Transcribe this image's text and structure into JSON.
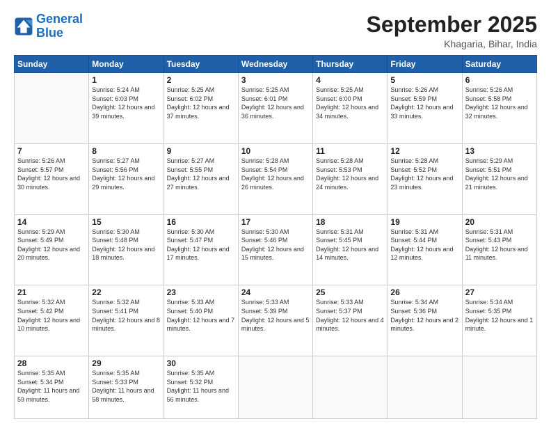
{
  "header": {
    "logo_line1": "General",
    "logo_line2": "Blue",
    "month": "September 2025",
    "location": "Khagaria, Bihar, India"
  },
  "weekdays": [
    "Sunday",
    "Monday",
    "Tuesday",
    "Wednesday",
    "Thursday",
    "Friday",
    "Saturday"
  ],
  "weeks": [
    [
      {
        "day": "",
        "info": ""
      },
      {
        "day": "1",
        "info": "Sunrise: 5:24 AM\nSunset: 6:03 PM\nDaylight: 12 hours\nand 39 minutes."
      },
      {
        "day": "2",
        "info": "Sunrise: 5:25 AM\nSunset: 6:02 PM\nDaylight: 12 hours\nand 37 minutes."
      },
      {
        "day": "3",
        "info": "Sunrise: 5:25 AM\nSunset: 6:01 PM\nDaylight: 12 hours\nand 36 minutes."
      },
      {
        "day": "4",
        "info": "Sunrise: 5:25 AM\nSunset: 6:00 PM\nDaylight: 12 hours\nand 34 minutes."
      },
      {
        "day": "5",
        "info": "Sunrise: 5:26 AM\nSunset: 5:59 PM\nDaylight: 12 hours\nand 33 minutes."
      },
      {
        "day": "6",
        "info": "Sunrise: 5:26 AM\nSunset: 5:58 PM\nDaylight: 12 hours\nand 32 minutes."
      }
    ],
    [
      {
        "day": "7",
        "info": "Sunrise: 5:26 AM\nSunset: 5:57 PM\nDaylight: 12 hours\nand 30 minutes."
      },
      {
        "day": "8",
        "info": "Sunrise: 5:27 AM\nSunset: 5:56 PM\nDaylight: 12 hours\nand 29 minutes."
      },
      {
        "day": "9",
        "info": "Sunrise: 5:27 AM\nSunset: 5:55 PM\nDaylight: 12 hours\nand 27 minutes."
      },
      {
        "day": "10",
        "info": "Sunrise: 5:28 AM\nSunset: 5:54 PM\nDaylight: 12 hours\nand 26 minutes."
      },
      {
        "day": "11",
        "info": "Sunrise: 5:28 AM\nSunset: 5:53 PM\nDaylight: 12 hours\nand 24 minutes."
      },
      {
        "day": "12",
        "info": "Sunrise: 5:28 AM\nSunset: 5:52 PM\nDaylight: 12 hours\nand 23 minutes."
      },
      {
        "day": "13",
        "info": "Sunrise: 5:29 AM\nSunset: 5:51 PM\nDaylight: 12 hours\nand 21 minutes."
      }
    ],
    [
      {
        "day": "14",
        "info": "Sunrise: 5:29 AM\nSunset: 5:49 PM\nDaylight: 12 hours\nand 20 minutes."
      },
      {
        "day": "15",
        "info": "Sunrise: 5:30 AM\nSunset: 5:48 PM\nDaylight: 12 hours\nand 18 minutes."
      },
      {
        "day": "16",
        "info": "Sunrise: 5:30 AM\nSunset: 5:47 PM\nDaylight: 12 hours\nand 17 minutes."
      },
      {
        "day": "17",
        "info": "Sunrise: 5:30 AM\nSunset: 5:46 PM\nDaylight: 12 hours\nand 15 minutes."
      },
      {
        "day": "18",
        "info": "Sunrise: 5:31 AM\nSunset: 5:45 PM\nDaylight: 12 hours\nand 14 minutes."
      },
      {
        "day": "19",
        "info": "Sunrise: 5:31 AM\nSunset: 5:44 PM\nDaylight: 12 hours\nand 12 minutes."
      },
      {
        "day": "20",
        "info": "Sunrise: 5:31 AM\nSunset: 5:43 PM\nDaylight: 12 hours\nand 11 minutes."
      }
    ],
    [
      {
        "day": "21",
        "info": "Sunrise: 5:32 AM\nSunset: 5:42 PM\nDaylight: 12 hours\nand 10 minutes."
      },
      {
        "day": "22",
        "info": "Sunrise: 5:32 AM\nSunset: 5:41 PM\nDaylight: 12 hours\nand 8 minutes."
      },
      {
        "day": "23",
        "info": "Sunrise: 5:33 AM\nSunset: 5:40 PM\nDaylight: 12 hours\nand 7 minutes."
      },
      {
        "day": "24",
        "info": "Sunrise: 5:33 AM\nSunset: 5:39 PM\nDaylight: 12 hours\nand 5 minutes."
      },
      {
        "day": "25",
        "info": "Sunrise: 5:33 AM\nSunset: 5:37 PM\nDaylight: 12 hours\nand 4 minutes."
      },
      {
        "day": "26",
        "info": "Sunrise: 5:34 AM\nSunset: 5:36 PM\nDaylight: 12 hours\nand 2 minutes."
      },
      {
        "day": "27",
        "info": "Sunrise: 5:34 AM\nSunset: 5:35 PM\nDaylight: 12 hours\nand 1 minute."
      }
    ],
    [
      {
        "day": "28",
        "info": "Sunrise: 5:35 AM\nSunset: 5:34 PM\nDaylight: 11 hours\nand 59 minutes."
      },
      {
        "day": "29",
        "info": "Sunrise: 5:35 AM\nSunset: 5:33 PM\nDaylight: 11 hours\nand 58 minutes."
      },
      {
        "day": "30",
        "info": "Sunrise: 5:35 AM\nSunset: 5:32 PM\nDaylight: 11 hours\nand 56 minutes."
      },
      {
        "day": "",
        "info": ""
      },
      {
        "day": "",
        "info": ""
      },
      {
        "day": "",
        "info": ""
      },
      {
        "day": "",
        "info": ""
      }
    ]
  ]
}
